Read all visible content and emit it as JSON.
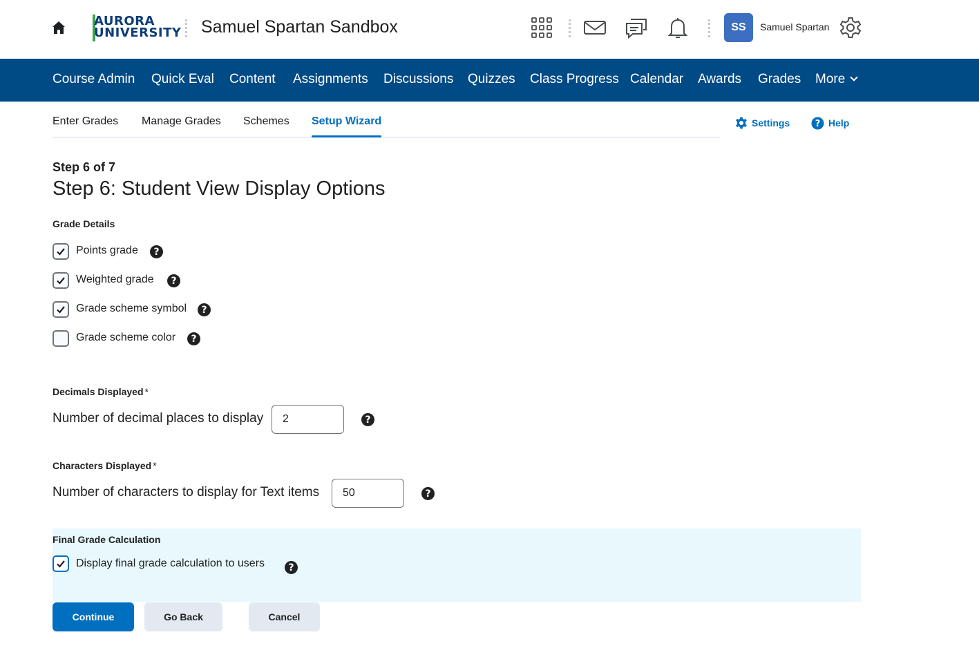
{
  "header": {
    "logo_line1": "AURORA",
    "logo_line2": "UNIVERSITY",
    "course_title": "Samuel Spartan Sandbox",
    "user_initials": "SS",
    "user_name": "Samuel Spartan",
    "icons": [
      "home-icon",
      "waffle-icon",
      "mail-icon",
      "chat-icon",
      "bell-icon",
      "gear-icon"
    ]
  },
  "nav": {
    "items": [
      "Course Admin",
      "Quick Eval",
      "Content",
      "Assignments",
      "Discussions",
      "Quizzes",
      "Class Progress",
      "Calendar",
      "Awards",
      "Grades"
    ],
    "more_label": "More"
  },
  "subtabs": {
    "items": [
      "Enter Grades",
      "Manage Grades",
      "Schemes",
      "Setup Wizard"
    ],
    "active": "Setup Wizard",
    "settings_label": "Settings",
    "help_label": "Help"
  },
  "page": {
    "step_count": "Step 6 of 7",
    "title": "Step 6: Student View Display Options"
  },
  "grade_details": {
    "label": "Grade Details",
    "options": [
      {
        "label": "Points grade",
        "checked": true
      },
      {
        "label": "Weighted grade",
        "checked": true
      },
      {
        "label": "Grade scheme symbol",
        "checked": true
      },
      {
        "label": "Grade scheme color",
        "checked": false
      }
    ]
  },
  "decimals": {
    "label": "Decimals Displayed",
    "required_mark": "*",
    "field_label": "Number of decimal places to display",
    "value": "2"
  },
  "characters": {
    "label": "Characters Displayed",
    "required_mark": "*",
    "field_label": "Number of characters to display for Text items",
    "value": "50"
  },
  "final_grade": {
    "label": "Final Grade Calculation",
    "option_label": "Display final grade calculation to users",
    "checked": true
  },
  "buttons": {
    "continue": "Continue",
    "go_back": "Go Back",
    "cancel": "Cancel"
  },
  "colors": {
    "nav_bg": "#004a86",
    "accent": "#006fbf",
    "panel_bg": "#e8f8fc",
    "avatar_bg": "#3d6fc0",
    "logo_green": "#3da54a",
    "logo_navy": "#0f3d77"
  }
}
